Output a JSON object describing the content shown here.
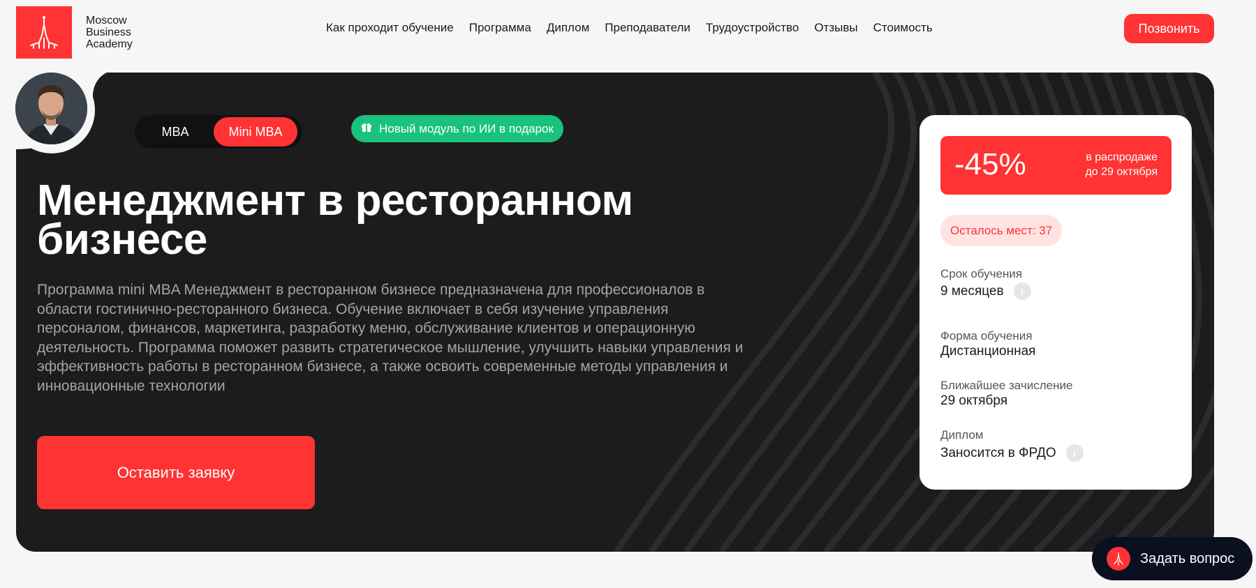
{
  "brand": {
    "name_line1": "Moscow",
    "name_line2": "Business",
    "name_line3": "Academy",
    "accent": "#ff3333",
    "green": "#19c37d"
  },
  "nav": {
    "items": [
      {
        "label": "Как проходит обучение"
      },
      {
        "label": "Программа"
      },
      {
        "label": "Диплом"
      },
      {
        "label": "Преподаватели"
      },
      {
        "label": "Трудоустройство"
      },
      {
        "label": "Отзывы"
      },
      {
        "label": "Стоимость"
      }
    ],
    "call_label": "Позвонить"
  },
  "hero": {
    "toggle": {
      "mba": "MBA",
      "mini_mba": "Mini MBA",
      "selected": "Mini MBA"
    },
    "gift_label": "Новый модуль по ИИ в подарок",
    "title_line1": "Менеджмент в ресторанном",
    "title_line2": "бизнесе",
    "description_lines": [
      "Программа mini MBA Менеджмент в ресторанном бизнесе предназначена для профессионалов в",
      "области гостинично-ресторанного бизнеса. Обучение включает в себя изучение управления",
      "персоналом, финансов, маркетинга, разработку меню, обслуживание клиентов и операционную",
      "деятельность. Программа поможет развить стратегическое мышление, улучшить навыки управления и",
      "эффективность работы в ресторанном бизнесе, а также освоить современные методы управления и",
      "инновационные технологии"
    ],
    "apply_label": "Оставить заявку"
  },
  "card": {
    "discount": "-45%",
    "sale_line1": "в распродаже",
    "sale_line2": "до 29 октября",
    "seats": "Осталось мест: 37",
    "duration_label": "Срок обучения",
    "duration_value": "9 месяцев",
    "form_label": "Форма обучения",
    "form_value": "Дистанционная",
    "enroll_label": "Ближайшее зачисление",
    "enroll_value": "29 октября",
    "diploma_label": "Диплом",
    "diploma_value": "Заносится в ФРДО"
  },
  "ask": {
    "label": "Задать вопрос"
  }
}
